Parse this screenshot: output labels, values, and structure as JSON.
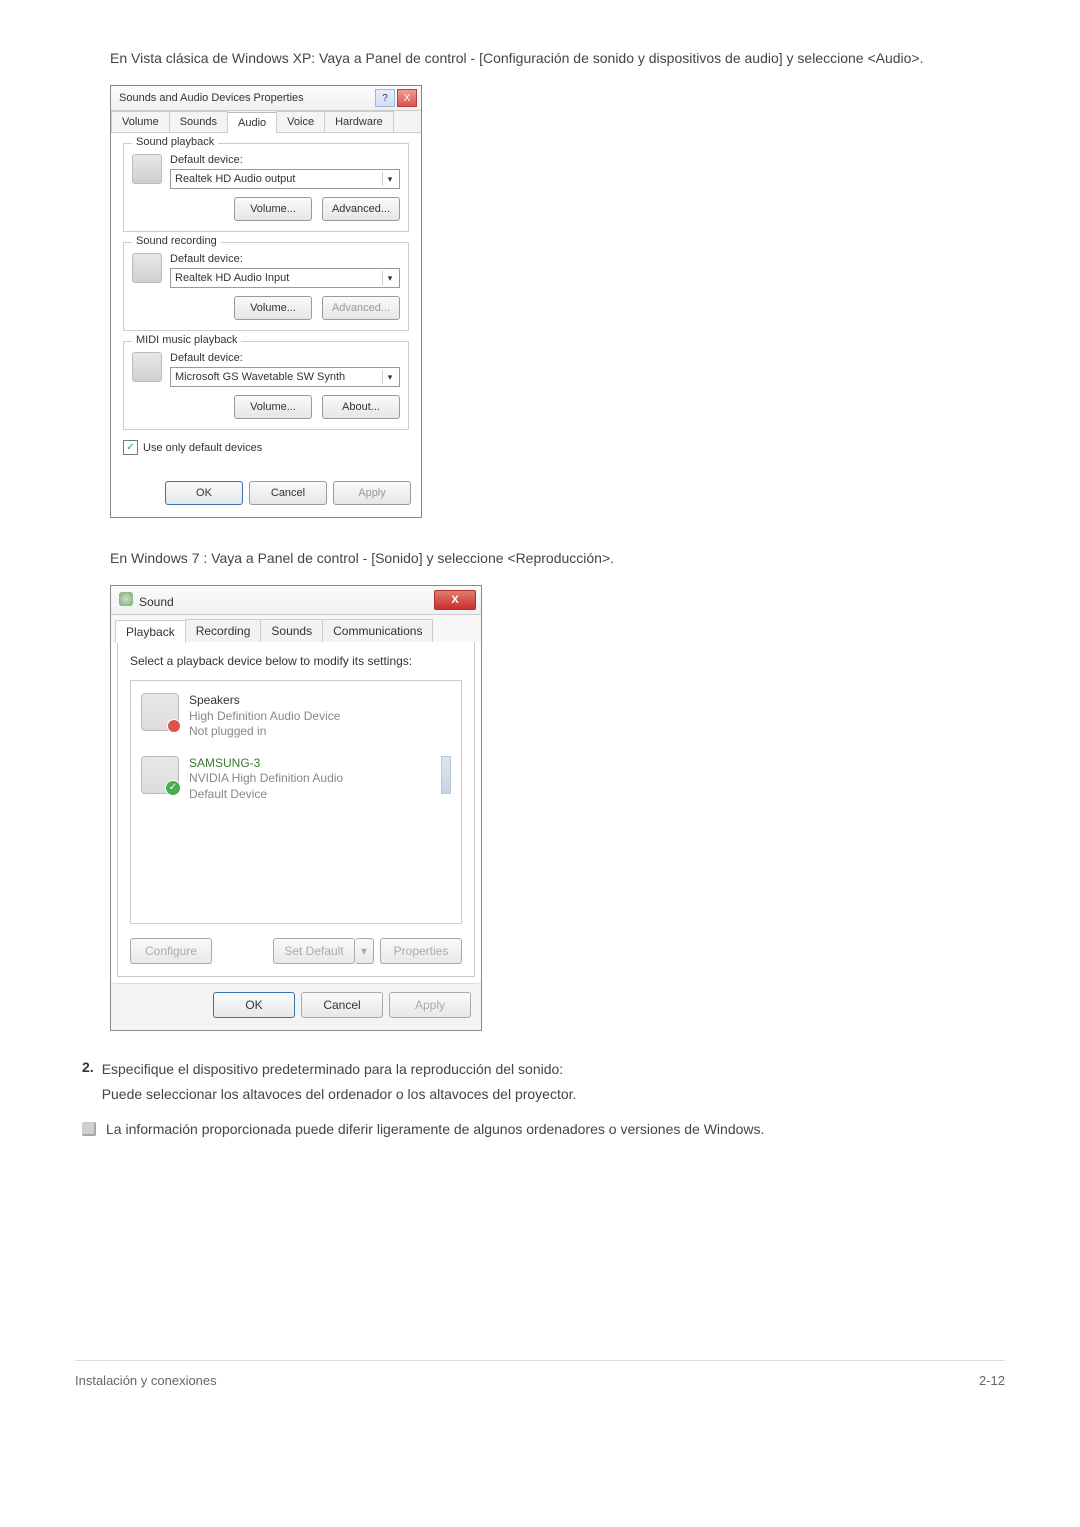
{
  "intro_xp": "En Vista clásica de Windows XP: Vaya a Panel de control - [Configuración de sonido y dispositivos de audio] y seleccione <Audio>.",
  "xp": {
    "title": "Sounds and Audio Devices Properties",
    "tabs": [
      "Volume",
      "Sounds",
      "Audio",
      "Voice",
      "Hardware"
    ],
    "active_tab": 2,
    "playback": {
      "legend": "Sound playback",
      "label": "Default device:",
      "value": "Realtek HD Audio output",
      "volume": "Volume...",
      "advanced": "Advanced..."
    },
    "recording": {
      "legend": "Sound recording",
      "label": "Default device:",
      "value": "Realtek HD Audio Input",
      "volume": "Volume...",
      "advanced": "Advanced..."
    },
    "midi": {
      "legend": "MIDI music playback",
      "label": "Default device:",
      "value": "Microsoft GS Wavetable SW Synth",
      "volume": "Volume...",
      "about": "About..."
    },
    "use_default": "Use only default devices",
    "ok": "OK",
    "cancel": "Cancel",
    "apply": "Apply"
  },
  "intro_w7": "En Windows 7 : Vaya a Panel de control - [Sonido] y seleccione <Reproducción>.",
  "w7": {
    "title": "Sound",
    "tabs": [
      "Playback",
      "Recording",
      "Sounds",
      "Communications"
    ],
    "active_tab": 0,
    "instruction": "Select a playback device below to modify its settings:",
    "dev1": {
      "name": "Speakers",
      "line2": "High Definition Audio Device",
      "status": "Not plugged in"
    },
    "dev2": {
      "name": "SAMSUNG-3",
      "line2": "NVIDIA High Definition Audio",
      "status": "Default Device"
    },
    "configure": "Configure",
    "setdefault": "Set Default",
    "properties": "Properties",
    "ok": "OK",
    "cancel": "Cancel",
    "apply": "Apply"
  },
  "step2": {
    "num": "2.",
    "l1": "Especifique el dispositivo predeterminado para la reproducción del sonido:",
    "l2": "Puede seleccionar los altavoces del ordenador o los altavoces del proyector."
  },
  "note": "La información proporcionada puede diferir ligeramente de algunos ordenadores o versiones de Windows.",
  "footer": {
    "left": "Instalación y conexiones",
    "right": "2-12"
  }
}
